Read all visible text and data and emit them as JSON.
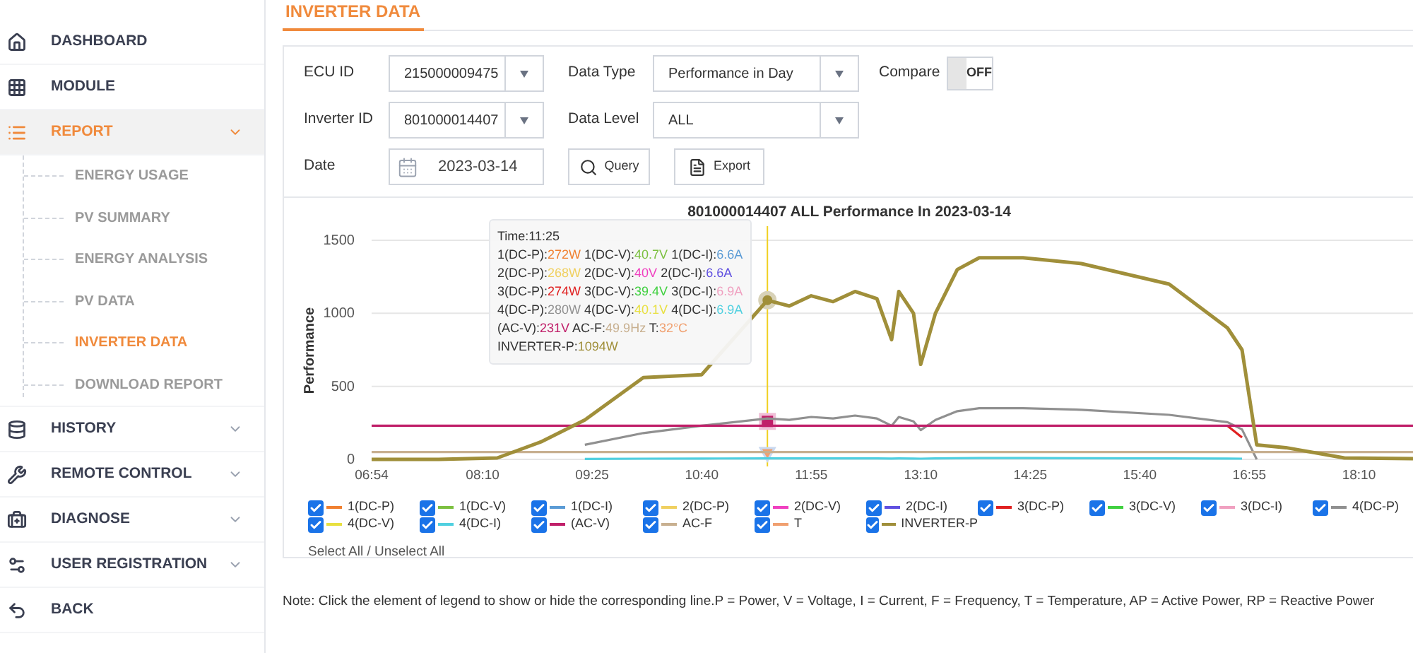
{
  "sidebar": {
    "items": [
      {
        "label": "DASHBOARD",
        "selected": false
      },
      {
        "label": "MODULE",
        "selected": false
      },
      {
        "label": "REPORT",
        "selected": true,
        "expanded": true,
        "children": [
          {
            "label": "ENERGY USAGE",
            "selected": false
          },
          {
            "label": "PV SUMMARY",
            "selected": false
          },
          {
            "label": "ENERGY ANALYSIS",
            "selected": false
          },
          {
            "label": "PV DATA",
            "selected": false
          },
          {
            "label": "INVERTER DATA",
            "selected": true
          },
          {
            "label": "DOWNLOAD REPORT",
            "selected": false
          }
        ]
      },
      {
        "label": "HISTORY",
        "selected": false,
        "expanded": false
      },
      {
        "label": "REMOTE CONTROL",
        "selected": false,
        "expanded": false
      },
      {
        "label": "DIAGNOSE",
        "selected": false,
        "expanded": false
      },
      {
        "label": "USER REGISTRATION",
        "selected": false,
        "expanded": false
      },
      {
        "label": "BACK",
        "selected": false
      }
    ]
  },
  "page_title": "INVERTER DATA",
  "form": {
    "ecu_id": {
      "label": "ECU ID",
      "value": "215000009475"
    },
    "data_type": {
      "label": "Data Type",
      "value": "Performance in Day"
    },
    "compare": {
      "label": "Compare",
      "text": "OFF",
      "on": false
    },
    "inverter_id": {
      "label": "Inverter ID",
      "value": "801000014407"
    },
    "data_level": {
      "label": "Data Level",
      "value": "ALL"
    },
    "date": {
      "label": "Date",
      "value": "2023-03-14"
    },
    "buttons": [
      {
        "label": "Query"
      },
      {
        "label": "Export"
      }
    ]
  },
  "chart": {
    "chart_data": {
      "type": "line",
      "title": "801000014407 ALL Performance In 2023-03-14",
      "ylabel": "Performance",
      "x": [
        414,
        460,
        500,
        530,
        560,
        600,
        640,
        685,
        700,
        715,
        730,
        745,
        760,
        770,
        775,
        785,
        790,
        800,
        815,
        830,
        860,
        900,
        960,
        1000,
        1010,
        1020,
        1040,
        1080,
        1128
      ],
      "xlim": [
        414,
        1128
      ],
      "xticks": [
        {
          "value": 414,
          "label": "06:54"
        },
        {
          "value": 490,
          "label": "08:10"
        },
        {
          "value": 565,
          "label": "09:25"
        },
        {
          "value": 640,
          "label": "10:40"
        },
        {
          "value": 715,
          "label": "11:55"
        },
        {
          "value": 790,
          "label": "13:10"
        },
        {
          "value": 865,
          "label": "14:25"
        },
        {
          "value": 940,
          "label": "15:40"
        },
        {
          "value": 1015,
          "label": "16:55"
        },
        {
          "value": 1090,
          "label": "18:10"
        }
      ],
      "yticks": [
        0,
        500,
        1000,
        1500
      ],
      "ylim": [
        0,
        1500
      ],
      "ref_lines": [
        {
          "axis": "x",
          "value": 685
        }
      ],
      "series": [
        {
          "name": "1(DC-P)",
          "color": "#f08030",
          "values": [
            null,
            null,
            null,
            null,
            null,
            null,
            null,
            null,
            null,
            null,
            null,
            null,
            null,
            null,
            null,
            null,
            null,
            null,
            null,
            null,
            null,
            null,
            null,
            null,
            null,
            null,
            null,
            null,
            null
          ]
        },
        {
          "name": "1(DC-V)",
          "color": "#7cc040",
          "values": [
            null,
            null,
            null,
            null,
            null,
            null,
            null,
            null,
            null,
            null,
            null,
            null,
            null,
            null,
            null,
            null,
            null,
            null,
            null,
            null,
            null,
            null,
            null,
            null,
            null,
            null,
            null,
            null,
            null
          ]
        },
        {
          "name": "1(DC-I)",
          "color": "#5b9bd5",
          "values": [
            null,
            null,
            null,
            null,
            null,
            null,
            null,
            null,
            null,
            null,
            null,
            null,
            null,
            null,
            null,
            null,
            null,
            null,
            null,
            null,
            null,
            null,
            null,
            null,
            null,
            null,
            null,
            null,
            null
          ]
        },
        {
          "name": "2(DC-P)",
          "color": "#f0d060",
          "values": [
            null,
            null,
            null,
            null,
            null,
            null,
            null,
            null,
            null,
            null,
            null,
            null,
            null,
            null,
            null,
            null,
            null,
            null,
            null,
            null,
            null,
            null,
            null,
            null,
            null,
            null,
            null,
            null,
            null
          ]
        },
        {
          "name": "2(DC-V)",
          "color": "#f040c0",
          "values": [
            null,
            null,
            null,
            null,
            null,
            null,
            null,
            null,
            null,
            null,
            null,
            null,
            null,
            null,
            null,
            null,
            null,
            null,
            null,
            null,
            null,
            null,
            null,
            null,
            null,
            null,
            null,
            null,
            null
          ]
        },
        {
          "name": "2(DC-I)",
          "color": "#6050e0",
          "values": [
            null,
            null,
            null,
            null,
            null,
            null,
            null,
            null,
            null,
            null,
            null,
            null,
            null,
            null,
            null,
            null,
            null,
            null,
            null,
            null,
            null,
            null,
            null,
            null,
            null,
            null,
            null,
            null,
            null
          ]
        },
        {
          "name": "3(DC-P)",
          "color": "#e02020",
          "values": [
            null,
            null,
            null,
            null,
            null,
            null,
            null,
            null,
            null,
            null,
            null,
            null,
            null,
            null,
            null,
            null,
            null,
            null,
            null,
            null,
            null,
            null,
            null,
            230,
            150,
            null,
            null,
            null,
            null
          ]
        },
        {
          "name": "3(DC-V)",
          "color": "#40d040",
          "values": [
            null,
            null,
            null,
            null,
            null,
            null,
            null,
            null,
            null,
            null,
            null,
            null,
            null,
            null,
            null,
            null,
            null,
            null,
            null,
            null,
            null,
            null,
            null,
            null,
            null,
            null,
            null,
            null,
            null
          ]
        },
        {
          "name": "3(DC-I)",
          "color": "#f0a0c0",
          "values": [
            null,
            null,
            null,
            null,
            null,
            null,
            null,
            null,
            null,
            null,
            null,
            null,
            null,
            null,
            null,
            null,
            null,
            null,
            null,
            null,
            null,
            null,
            null,
            null,
            null,
            null,
            null,
            null,
            null
          ]
        },
        {
          "name": "4(DC-P)",
          "color": "#909090",
          "values": [
            null,
            null,
            null,
            null,
            100,
            180,
            230,
            280,
            270,
            290,
            280,
            300,
            280,
            230,
            290,
            260,
            200,
            270,
            330,
            350,
            350,
            340,
            305,
            255,
            205,
            0,
            null,
            null,
            null
          ]
        },
        {
          "name": "4(DC-V)",
          "color": "#e8e040",
          "values": [
            null,
            null,
            null,
            null,
            null,
            null,
            null,
            null,
            null,
            null,
            null,
            null,
            null,
            null,
            null,
            null,
            null,
            null,
            null,
            null,
            null,
            null,
            null,
            null,
            null,
            null,
            null,
            null,
            null
          ]
        },
        {
          "name": "4(DC-I)",
          "color": "#50d0e0",
          "values": [
            null,
            null,
            null,
            null,
            3,
            5,
            6,
            7,
            7,
            7,
            7,
            7,
            7,
            6,
            7,
            6,
            5,
            7,
            8,
            9,
            9,
            8,
            7,
            6,
            5,
            null,
            null,
            null,
            null
          ]
        },
        {
          "name": "(AC-V)",
          "color": "#c0206a",
          "values": [
            230,
            230,
            230,
            230,
            230,
            230,
            230,
            230,
            230,
            230,
            230,
            230,
            230,
            230,
            230,
            230,
            230,
            230,
            230,
            230,
            230,
            230,
            230,
            230,
            230,
            230,
            230,
            230,
            230
          ]
        },
        {
          "name": "AC-F",
          "color": "#c8b090",
          "values": [
            50,
            50,
            50,
            50,
            50,
            50,
            50,
            50,
            50,
            50,
            50,
            50,
            50,
            50,
            50,
            50,
            50,
            50,
            50,
            50,
            50,
            50,
            50,
            50,
            50,
            50,
            50,
            50,
            50
          ]
        },
        {
          "name": "T",
          "color": "#f0a070",
          "values": [
            null,
            null,
            null,
            null,
            null,
            null,
            null,
            null,
            null,
            null,
            null,
            null,
            null,
            null,
            null,
            null,
            null,
            null,
            null,
            null,
            null,
            null,
            null,
            null,
            null,
            null,
            null,
            null,
            null
          ]
        },
        {
          "name": "INVERTER-P",
          "color": "#a08f3a",
          "values": [
            0,
            0,
            10,
            120,
            270,
            560,
            580,
            1090,
            1050,
            1120,
            1080,
            1150,
            1100,
            820,
            1150,
            1000,
            650,
            1000,
            1300,
            1380,
            1380,
            1340,
            1200,
            900,
            750,
            100,
            80,
            10,
            5
          ]
        }
      ]
    },
    "tooltip": {
      "title": "Time:11:25",
      "lines": [
        [
          {
            "label": "1(DC-P):",
            "value": "272W",
            "color": "#f08030"
          },
          {
            "label": "1(DC-V):",
            "value": "40.7V",
            "color": "#7cc040"
          },
          {
            "label": "1(DC-I):",
            "value": "6.6A",
            "color": "#5b9bd5"
          }
        ],
        [
          {
            "label": "2(DC-P):",
            "value": "268W",
            "color": "#f0d060"
          },
          {
            "label": "2(DC-V):",
            "value": "40V",
            "color": "#f040c0"
          },
          {
            "label": "2(DC-I):",
            "value": "6.6A",
            "color": "#6050e0"
          }
        ],
        [
          {
            "label": "3(DC-P):",
            "value": "274W",
            "color": "#e02020"
          },
          {
            "label": "3(DC-V):",
            "value": "39.4V",
            "color": "#40d040"
          },
          {
            "label": "3(DC-I):",
            "value": "6.9A",
            "color": "#f0a0c0"
          }
        ],
        [
          {
            "label": "4(DC-P):",
            "value": "280W",
            "color": "#909090"
          },
          {
            "label": "4(DC-V):",
            "value": "40.1V",
            "color": "#e8e040"
          },
          {
            "label": "4(DC-I):",
            "value": "6.9A",
            "color": "#50d0e0"
          }
        ],
        [
          {
            "label": "(AC-V):",
            "value": "231V",
            "color": "#c0206a"
          },
          {
            "label": "AC-F:",
            "value": "49.9Hz",
            "color": "#c8b090"
          },
          {
            "label": "T:",
            "value": "32°C",
            "color": "#f0a070"
          }
        ],
        [
          {
            "label": "INVERTER-P:",
            "value": "1094W",
            "color": "#a08f3a"
          }
        ]
      ]
    },
    "legend": {
      "items": [
        {
          "checked": true
        },
        {
          "checked": true
        },
        {
          "checked": true
        },
        {
          "checked": true
        },
        {
          "checked": true
        },
        {
          "checked": true
        },
        {
          "checked": true
        },
        {
          "checked": true
        },
        {
          "checked": true
        },
        {
          "checked": true
        },
        {
          "checked": true
        },
        {
          "checked": true
        },
        {
          "checked": true
        },
        {
          "checked": true
        },
        {
          "checked": true
        },
        {
          "checked": true
        }
      ],
      "select_all": "Select All / Unselect All"
    }
  },
  "note": "Note: Click the element of legend to show or hide the corresponding line.P = Power, V = Voltage, I = Current, F = Frequency, T = Temperature, AP = Active Power, RP = Reactive Power"
}
